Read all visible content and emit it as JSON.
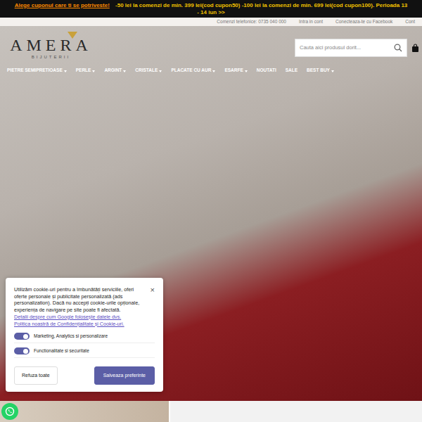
{
  "promo": {
    "highlight": "Alege cuponul care ti se potriveste!",
    "text": "-50 lei la comenzi de min. 399 lei(cod cupon50) -100 lei la comenzi de min. 699 lei(cod cupon100). Perioada 13 - 14 iun >>"
  },
  "info_bar": [
    "Comenzi telefonice: 0735 040 000",
    "Intra in cont",
    "Conecteaza-te cu Facebook",
    "Cont"
  ],
  "logo": {
    "name": "AMERA",
    "tagline": "BIJUTERII"
  },
  "search": {
    "placeholder": "Cauta aici produsul dorit..."
  },
  "nav": [
    {
      "label": "PIETRE SEMIPRETIOASE",
      "has_dropdown": true
    },
    {
      "label": "PERLE",
      "has_dropdown": true
    },
    {
      "label": "ARGINT",
      "has_dropdown": true
    },
    {
      "label": "CRISTALE",
      "has_dropdown": true
    },
    {
      "label": "PLACATE CU AUR",
      "has_dropdown": true
    },
    {
      "label": "ESARFE",
      "has_dropdown": true
    },
    {
      "label": "NOUTATI",
      "has_dropdown": false
    },
    {
      "label": "SALE",
      "has_dropdown": false
    },
    {
      "label": "BEST BUY",
      "has_dropdown": true
    }
  ],
  "cookie_dialog": {
    "close": "×",
    "text": "Utilizăm cookie-uri pentru a îmbunătăți serviciile, oferi oferte personale și publicitate personalizată (ads personalization). Dacă nu accepți cookie-urile opționale, experiența de navigare pe site poate fi afectată.",
    "links": [
      "Detalii despre cum Google folosește datele dvs.",
      "Politica noastră de Confidențialitate și Cookie-uri."
    ],
    "toggles": [
      {
        "label": "Marketing, Analytics si personalizare",
        "on": true
      },
      {
        "label": "Functionalitate si securitate",
        "on": true
      }
    ],
    "buttons": [
      {
        "label": "Refuza toate",
        "primary": false
      },
      {
        "label": "Salveaza preferinte",
        "primary": true
      }
    ]
  }
}
